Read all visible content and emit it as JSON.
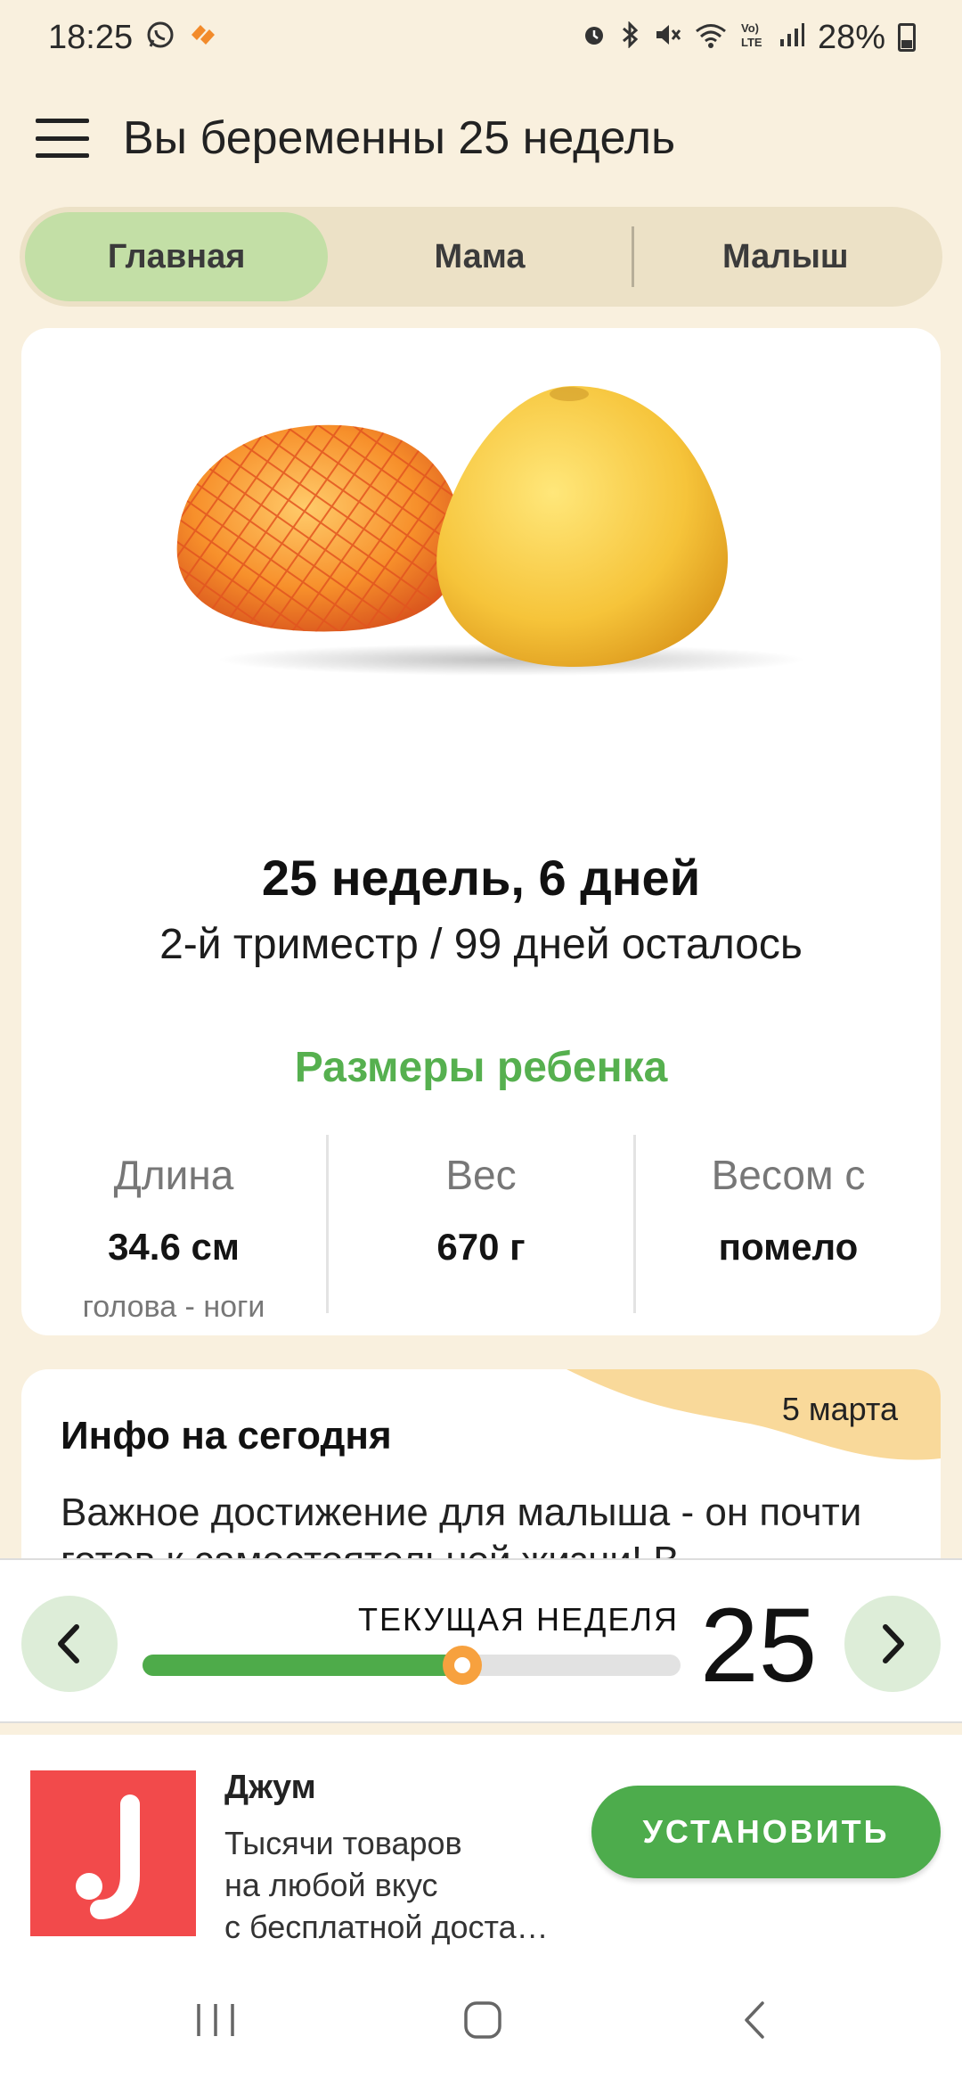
{
  "status_bar": {
    "time": "18:25",
    "battery": "28%",
    "icons": [
      "whatsapp-icon",
      "notification-app-icon",
      "alarm-icon",
      "bluetooth-icon",
      "mute-icon",
      "wifi-icon",
      "volte-icon",
      "signal-icon",
      "battery-icon"
    ]
  },
  "app_bar": {
    "title": "Вы беременны 25 недель",
    "menu_icon": "hamburger-menu-icon"
  },
  "tabs": [
    {
      "label": "Главная",
      "active": true
    },
    {
      "label": "Мама",
      "active": false
    },
    {
      "label": "Малыш",
      "active": false
    }
  ],
  "main_card": {
    "image": "pomelo-fruit-image",
    "weeks": "25 недель, 6 дней",
    "trimester": "2-й триместр / 99 дней осталось",
    "sizes_title": "Размеры ребенка",
    "stats": [
      {
        "label": "Длина",
        "value": "34.6 см",
        "sub": "голова - ноги"
      },
      {
        "label": "Вес",
        "value": "670 г",
        "sub": ""
      },
      {
        "label": "Весом с",
        "value": "помело",
        "sub": ""
      }
    ]
  },
  "info_card": {
    "date": "5 марта",
    "title": "Инфо на сегодня",
    "text": "Важное достижение для малыша - он почти готов к самостоятельной жизни! В"
  },
  "week_selector": {
    "label": "ТЕКУЩАЯ НЕДЕЛЯ",
    "week": "25",
    "progress": 0.595,
    "prev_icon": "chevron-left-icon",
    "next_icon": "chevron-right-icon"
  },
  "ad": {
    "title": "Джум",
    "lines": [
      "Тысячи товаров",
      "на любой вкус",
      "с бесплатной доста…"
    ],
    "button": "УСТАНОВИТЬ",
    "logo_color": "#f24a4b"
  },
  "colors": {
    "background": "#f9f0de",
    "accent_green": "#4eab4a",
    "active_tab": "#c3dfa6",
    "thumb_orange": "#f7a13e",
    "date_wave": "#f9d99a"
  }
}
